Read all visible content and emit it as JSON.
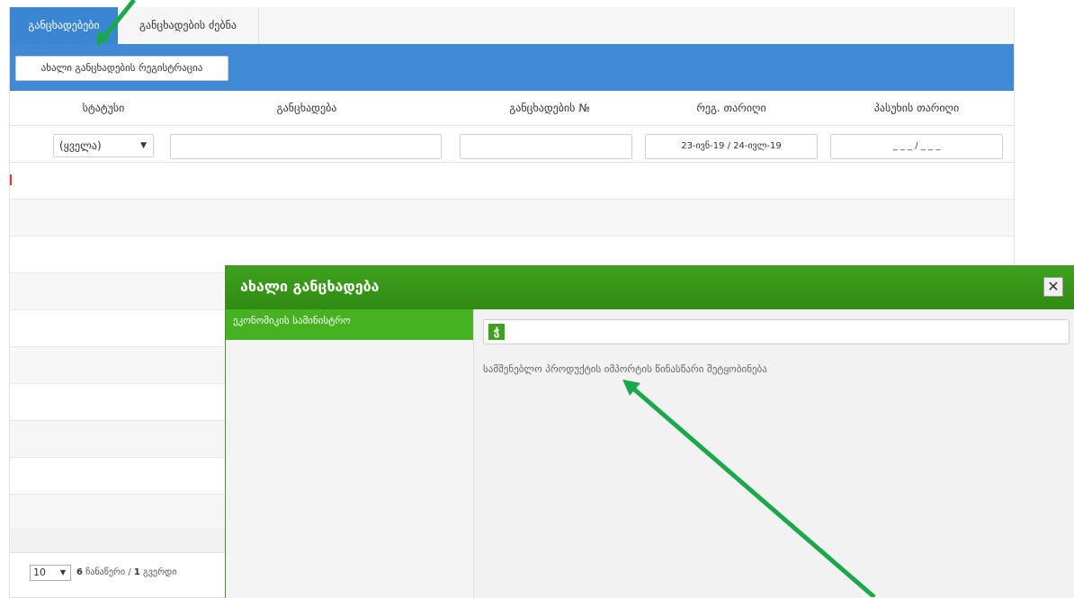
{
  "tabs": [
    {
      "label": "განცხადებები",
      "active": true
    },
    {
      "label": "განცხადების ძებნა",
      "active": false
    }
  ],
  "toolbar": {
    "register_label": "ახალი განცხადების რეგისტრაცია"
  },
  "table": {
    "headers": [
      "სტატუსი",
      "განცხადება",
      "განცხადების №",
      "რეგ. თარიღი",
      "პასუხის თარიღი"
    ],
    "filters": {
      "status": "(ყველა)",
      "application": "",
      "number": "",
      "reg_date": "23-ივნ-19 / 24-ივლ-19",
      "answer_date": "_ _ _ / _ _ _"
    }
  },
  "pagination": {
    "page_size": "10",
    "records_count": "6",
    "records_label": "ჩანაწერი /",
    "pages_count": "1",
    "pages_label": "გვერდი"
  },
  "modal": {
    "title": "ახალი განცხადება",
    "close_icon": "close-icon",
    "sidebar_items": [
      "ეკონომიკის სამინისტრო"
    ],
    "search_value": "",
    "results": [
      "სამშენებლო პროდუქტის იმპორტის წინასწარი შეტყობინება"
    ]
  },
  "colors": {
    "tab_active": "#3b86d2",
    "toolbar": "#4189d4",
    "modal_header": "#3a9a1c",
    "sidebar_active": "#46b222",
    "annotation_arrow": "#1aa84b"
  }
}
